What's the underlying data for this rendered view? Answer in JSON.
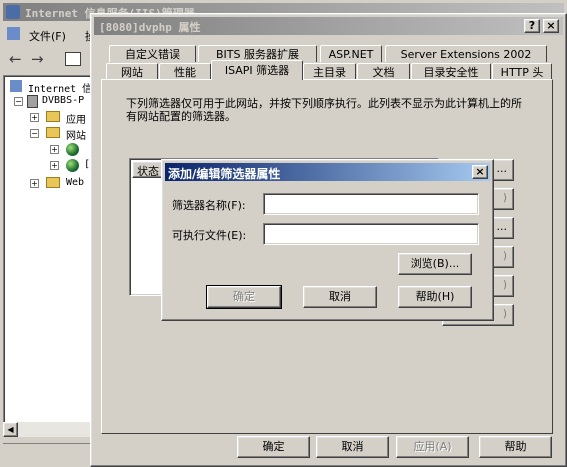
{
  "main_window": {
    "title": "Internet 信息服务(IIS)管理器",
    "menu": [
      {
        "label": "文件(F)"
      },
      {
        "label": "操"
      }
    ],
    "tree": {
      "root": "Internet 信",
      "server": "DVBBS-P",
      "items": [
        {
          "label": "应用"
        },
        {
          "label": "网站"
        },
        {
          "label": ""
        },
        {
          "label": "["
        },
        {
          "label": "Web"
        }
      ]
    }
  },
  "props_dialog": {
    "title": "[8080]dvphp 属性",
    "help_btn": "?",
    "close_btn": "×",
    "tabs_row1": [
      {
        "label": "自定义错误"
      },
      {
        "label": "BITS 服务器扩展"
      },
      {
        "label": "ASP.NET"
      },
      {
        "label": "Server Extensions 2002"
      }
    ],
    "tabs_row2": [
      {
        "label": "网站"
      },
      {
        "label": "性能"
      },
      {
        "label": "ISAPI 筛选器"
      },
      {
        "label": "主目录"
      },
      {
        "label": "文档"
      },
      {
        "label": "目录安全性"
      },
      {
        "label": "HTTP 头"
      }
    ],
    "description": "下列筛选器仅可用于此网站，并按下列顺序执行。此列表不显示为此计算机上的所有网站配置的筛选器。",
    "list_header_status": "状态",
    "side_buttons": [
      "...",
      ")",
      "...",
      ")",
      ")",
      ")"
    ],
    "footer": {
      "ok": "确定",
      "cancel": "取消",
      "apply": "应用(A)",
      "help": "帮助"
    }
  },
  "edit_dialog": {
    "title": "添加/编辑筛选器属性",
    "close_btn": "×",
    "name_label": "筛选器名称(F):",
    "name_value": "",
    "exe_label": "可执行文件(E):",
    "exe_value": "",
    "browse": "浏览(B)...",
    "ok": "确定",
    "cancel": "取消",
    "help": "帮助(H)"
  }
}
